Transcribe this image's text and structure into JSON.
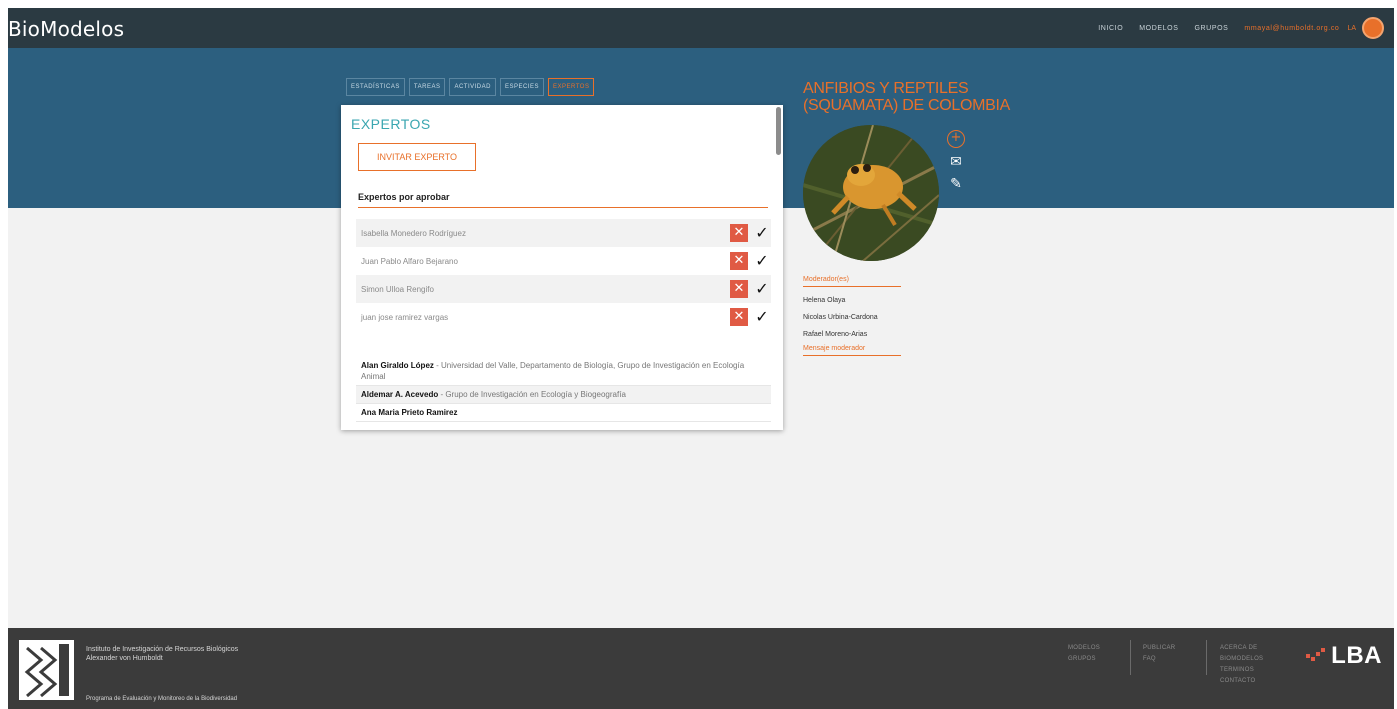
{
  "app": {
    "brand": "BioModelos"
  },
  "topnav": {
    "items": [
      "INICIO",
      "MODELOS",
      "GRUPOS"
    ],
    "email": "mmayal@humboldt.org.co",
    "lang": "LA"
  },
  "tabs": [
    {
      "label": "ESTADÍSTICAS",
      "active": false
    },
    {
      "label": "TAREAS",
      "active": false
    },
    {
      "label": "ACTIVIDAD",
      "active": false
    },
    {
      "label": "ESPECIES",
      "active": false
    },
    {
      "label": "EXPERTOS",
      "active": true
    }
  ],
  "panel": {
    "title": "EXPERTOS",
    "invite_label": "INVITAR EXPERTO",
    "pending_heading": "Expertos por aprobar",
    "pending": [
      {
        "name": "Isabella Monedero Rodríguez"
      },
      {
        "name": "Juan Pablo Alfaro Bejarano"
      },
      {
        "name": "Simon Ulloa Rengifo"
      },
      {
        "name": "juan jose ramirez vargas"
      }
    ],
    "experts": [
      {
        "name": "Alan Giraldo López",
        "affiliation": " - Universidad del Valle, Departamento de Biología, Grupo de Investigación en Ecología Animal"
      },
      {
        "name": "Aldemar A. Acevedo",
        "affiliation": " - Grupo de Investigación en Ecología y Biogeografía"
      },
      {
        "name": "Ana Maria Prieto Ramirez",
        "affiliation": ""
      }
    ]
  },
  "group": {
    "title": "ANFIBIOS Y REPTILES (SQUAMATA) DE COLOMBIA",
    "moderators_heading": "Moderador(es)",
    "moderators": [
      "Helena Olaya",
      "Nicolas Urbina-Cardona",
      "Rafael Moreno-Arias"
    ],
    "message_link": "Mensaje moderador"
  },
  "footer": {
    "institute_line1": "Instituto de Investigación de Recursos Biológicos",
    "institute_line2": "Alexander von Humboldt",
    "program": "Programa de Evaluación y Monitoreo de la Biodiversidad",
    "col1": [
      "MODELOS",
      "GRUPOS"
    ],
    "col2": [
      "PUBLICAR",
      "FAQ"
    ],
    "col3": [
      "ACERCA DE BIOMODELOS",
      "TERMINOS",
      "CONTACTO"
    ],
    "partner_logo": "LBA"
  },
  "colors": {
    "accent": "#e8702a",
    "teal": "#3aa6b0",
    "navbar": "#2b3a42",
    "banner": "#2c5f7f",
    "footer": "#3b3b3b",
    "reject": "#e05a44"
  }
}
